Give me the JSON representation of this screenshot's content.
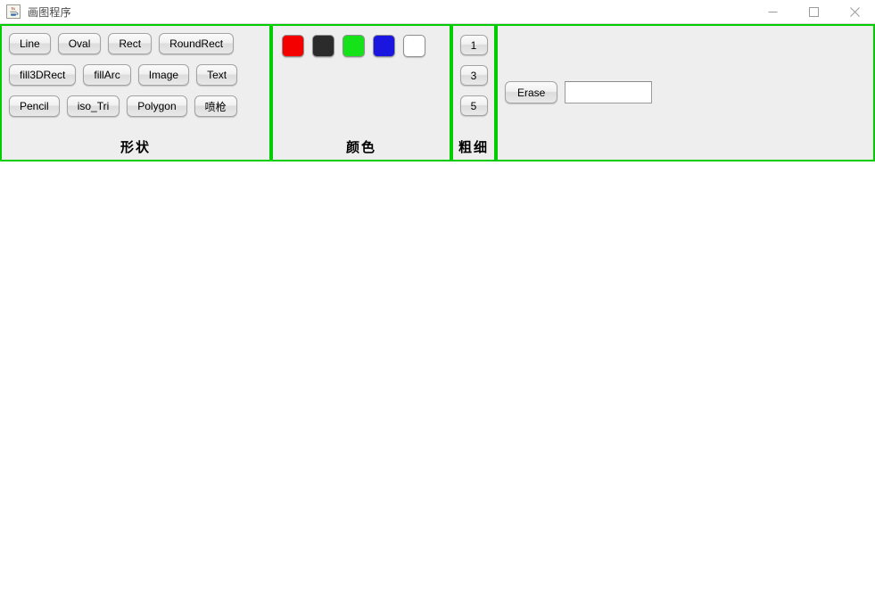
{
  "window": {
    "title": "画图程序",
    "icon": "java-coffee-cup-icon",
    "controls": {
      "minimize": "minimize-icon",
      "maximize": "maximize-icon",
      "close": "close-icon"
    }
  },
  "theme": {
    "panel_border": "#00cc00",
    "panel_background": "#eeeeee",
    "toolbar_background": "#f0f0f0",
    "canvas_background": "#ffffff"
  },
  "panels": {
    "shapes": {
      "title": "形状",
      "rows": [
        [
          {
            "label": "Line",
            "name": "shape-button-line"
          },
          {
            "label": "Oval",
            "name": "shape-button-oval"
          },
          {
            "label": "Rect",
            "name": "shape-button-rect"
          },
          {
            "label": "RoundRect",
            "name": "shape-button-roundrect"
          }
        ],
        [
          {
            "label": "fill3DRect",
            "name": "shape-button-fill3drect"
          },
          {
            "label": "fillArc",
            "name": "shape-button-fillarc"
          },
          {
            "label": "Image",
            "name": "shape-button-image"
          },
          {
            "label": "Text",
            "name": "shape-button-text"
          }
        ],
        [
          {
            "label": "Pencil",
            "name": "shape-button-pencil"
          },
          {
            "label": "iso_Tri",
            "name": "shape-button-iso-tri"
          },
          {
            "label": "Polygon",
            "name": "shape-button-polygon"
          },
          {
            "label": "喷枪",
            "name": "shape-button-spray"
          }
        ]
      ]
    },
    "colors": {
      "title": "颜色",
      "swatches": [
        {
          "name": "color-swatch-red",
          "label": "red",
          "color": "#f50000"
        },
        {
          "name": "color-swatch-black",
          "label": "black",
          "color": "#2b2b2b"
        },
        {
          "name": "color-swatch-green",
          "label": "green",
          "color": "#15e218"
        },
        {
          "name": "color-swatch-blue",
          "label": "blue",
          "color": "#1a16e0"
        },
        {
          "name": "color-swatch-white",
          "label": "white",
          "color": "#ffffff"
        }
      ]
    },
    "thickness": {
      "title": "粗细",
      "buttons": [
        {
          "label": "1",
          "name": "thickness-button-1"
        },
        {
          "label": "3",
          "name": "thickness-button-3"
        },
        {
          "label": "5",
          "name": "thickness-button-5"
        }
      ]
    },
    "erase": {
      "button_label": "Erase",
      "input_value": "",
      "input_placeholder": ""
    }
  }
}
